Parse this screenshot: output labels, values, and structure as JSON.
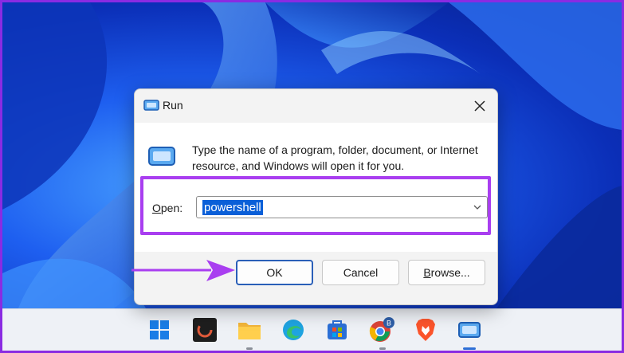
{
  "dialog": {
    "title": "Run",
    "description": "Type the name of a program, folder, document, or Internet resource, and Windows will open it for you.",
    "open_label_mnemonic": "O",
    "open_label_rest": "pen:",
    "open_value": "powershell",
    "buttons": {
      "ok": "OK",
      "cancel": "Cancel",
      "browse_mnemonic": "B",
      "browse_rest": "rowse..."
    }
  },
  "taskbar": {
    "items": [
      {
        "name": "start",
        "icon": "windows-logo-icon"
      },
      {
        "name": "app-dark",
        "icon": "dark-app-icon"
      },
      {
        "name": "file-explorer",
        "icon": "folder-icon"
      },
      {
        "name": "edge",
        "icon": "edge-icon"
      },
      {
        "name": "store",
        "icon": "store-icon"
      },
      {
        "name": "chrome",
        "icon": "chrome-icon",
        "badge": "B"
      },
      {
        "name": "brave",
        "icon": "brave-icon"
      },
      {
        "name": "run",
        "icon": "run-icon"
      }
    ]
  },
  "colors": {
    "highlight_border": "#a93ef0",
    "selection": "#0a5fd8",
    "ok_border": "#2a5fb8",
    "arrow": "#a93ef0"
  }
}
